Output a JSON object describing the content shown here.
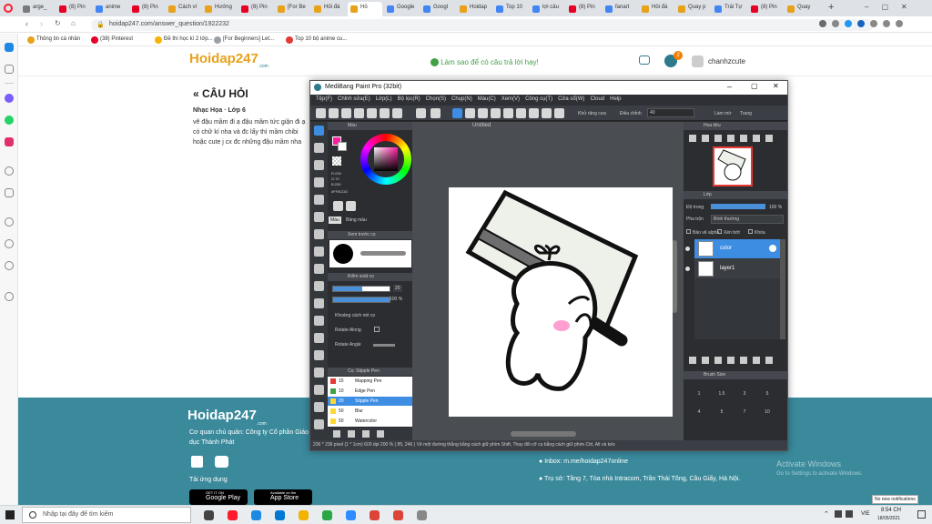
{
  "browser": {
    "tabs": [
      {
        "label": "arge_",
        "color": "#7a7a7a"
      },
      {
        "label": "(8) Pin",
        "color": "#e60023"
      },
      {
        "label": "anime",
        "color": "#4285f4"
      },
      {
        "label": "(8) Pin",
        "color": "#e60023"
      },
      {
        "label": "Cách ví",
        "color": "#e8a11a"
      },
      {
        "label": "Hướng",
        "color": "#e8a11a"
      },
      {
        "label": "(8) Pin",
        "color": "#e60023"
      },
      {
        "label": "[For Be",
        "color": "#e8a11a"
      },
      {
        "label": "Hỏi đá",
        "color": "#e8a11a"
      },
      {
        "label": "Hỏ",
        "color": "#e8a11a"
      },
      {
        "label": "Google",
        "color": "#4285f4"
      },
      {
        "label": "Googl",
        "color": "#4285f4"
      },
      {
        "label": "Hoidap",
        "color": "#e8a11a"
      },
      {
        "label": "Top 10",
        "color": "#4285f4"
      },
      {
        "label": "lợi câu",
        "color": "#4285f4"
      },
      {
        "label": "(8) Pin",
        "color": "#e60023"
      },
      {
        "label": "fanart",
        "color": "#4285f4"
      },
      {
        "label": "Hỏi đá",
        "color": "#e8a11a"
      },
      {
        "label": "Quay p",
        "color": "#e8a11a"
      },
      {
        "label": "Trái Tự",
        "color": "#4285f4"
      },
      {
        "label": "(8) Pin",
        "color": "#e60023"
      },
      {
        "label": "Quay",
        "color": "#e8a11a"
      }
    ],
    "url": "hoidap247.com/answer_question/1922232",
    "bookmarks": [
      {
        "label": "Thông tin cá nhân",
        "color": "#e8a11a"
      },
      {
        "label": "(38) Pinterest",
        "color": "#e60023"
      },
      {
        "label": "Đề thi học kì 2 lớp...",
        "color": "#f4b400"
      },
      {
        "label": "[For Beginners] Let...",
        "color": "#9aa0a6"
      },
      {
        "label": "Top 10 bộ anime cu...",
        "color": "#e53935"
      }
    ]
  },
  "site": {
    "logo": "Hoidap247",
    "logo_sub": ".com",
    "help_link": "Làm sao để có câu trả lời hay!",
    "notif_count": "2",
    "username": "chanhzcute",
    "section_title": "CÂU HỎI",
    "subject": "Nhạc Họa · Lớp 6",
    "question_text": "vẽ đậu mầm đi ạ đậu mầm tức giận đi ạ có chữ kí nha và đc lấy thì mầm chibi hoặc cute j cx đc những đậu mầm nha",
    "footer": {
      "logo": "Hoidap247",
      "logo_sub": ".com",
      "company": "Cơ quan chủ quản: Công ty Cổ phần Giáo dục Thành Phát",
      "download": "Tải ứng dụng",
      "google_play_small": "GET IT ON",
      "google_play": "Google Play",
      "app_store_small": "Available on the",
      "app_store": "App Store",
      "inbox": "Inbox: m.me/hoidap247online",
      "address": "Trụ sở: Tầng 7, Tòa nhà Intracom, Trần Thái Tông, Cầu Giấy, Hà Nội."
    }
  },
  "medibang": {
    "title": "MediBang Paint Pro (32bit)",
    "menu": [
      "Tệp(F)",
      "Chỉnh sửa(E)",
      "Lớp(L)",
      "Bộ lọc(R)",
      "Chọn(S)",
      "Chụp(N)",
      "Màu(C)",
      "Xem(V)",
      "Công cụ(T)",
      "Cửa sổ(W)",
      "Cloud",
      "Help"
    ],
    "toolbar_text": {
      "snap": "Khử răng cưa",
      "correction_label": "Điều chỉnh",
      "correction_value": "40",
      "snap_off": "Làm mờ",
      "page": "Trang"
    },
    "canvas_tab": "Untitled",
    "color_panel": "Màu",
    "color_codes": "R:235 G:70 B:205",
    "hex": "#FF8CDD",
    "color_tabs": [
      "Màu",
      "Bảng màu"
    ],
    "brush_preview_panel": "Xem trước cọ",
    "brush_size_panel": "Kiểm soát cọ",
    "brush_size_value": "20",
    "brush_opacity_value": "100 %",
    "brush_opts": [
      "Khoảng cách nét cọ",
      "Rotate Along",
      "Rotate Angle"
    ],
    "brush_list_panel": "Cọ: Stipple Pen",
    "brushes": [
      {
        "size": "15",
        "name": "Mapping Pen",
        "color": "#e53935"
      },
      {
        "size": "10",
        "name": "Edge Pen",
        "color": "#43a047"
      },
      {
        "size": "20",
        "name": "Stipple Pen",
        "color": "#fdd835",
        "selected": true
      },
      {
        "size": "50",
        "name": "Blur",
        "color": "#fdd835"
      },
      {
        "size": "50",
        "name": "Watercolor",
        "color": "#fdd835"
      }
    ],
    "navigator_panel": "Hoa tiêu",
    "layer_panel": "Lớp",
    "opacity_label": "Độ trong",
    "opacity_value": "100 %",
    "blend_label": "Pha trộn",
    "blend_value": "Bình thường",
    "layer_checks": [
      "Bảo vệ alpha",
      "Xén bớt",
      "Khóa"
    ],
    "layers": [
      {
        "name": "color",
        "active": true
      },
      {
        "name": "layer1",
        "active": false
      }
    ],
    "brush_size_panel2": "Brush Size",
    "size_grid": [
      "1",
      "1.5",
      "3",
      "5",
      "4",
      "5",
      "7",
      "10"
    ],
    "status": "236 * 236 pixel  (1 * 1cm)  600 dpi  200 %  ( 85, 246 )  Vẽ một đường thẳng bằng cách giữ phím Shift, Thay đổi cỡ cọ bằng cách giữ phím Ctrl, Alt và kéo",
    "canvas_colors": {
      "paper": "#eef1ea",
      "bar": "#6e6e6e",
      "blush": "#ff9fd1"
    }
  },
  "windows": {
    "activate_title": "Activate Windows",
    "activate_sub": "Go to Settings to activate Windows.",
    "notification": "No new notifications",
    "search_placeholder": "Nhập tại đây để tìm kiếm",
    "time": "8:54 CH",
    "date": "18/05/2021",
    "lang": "VIE"
  }
}
